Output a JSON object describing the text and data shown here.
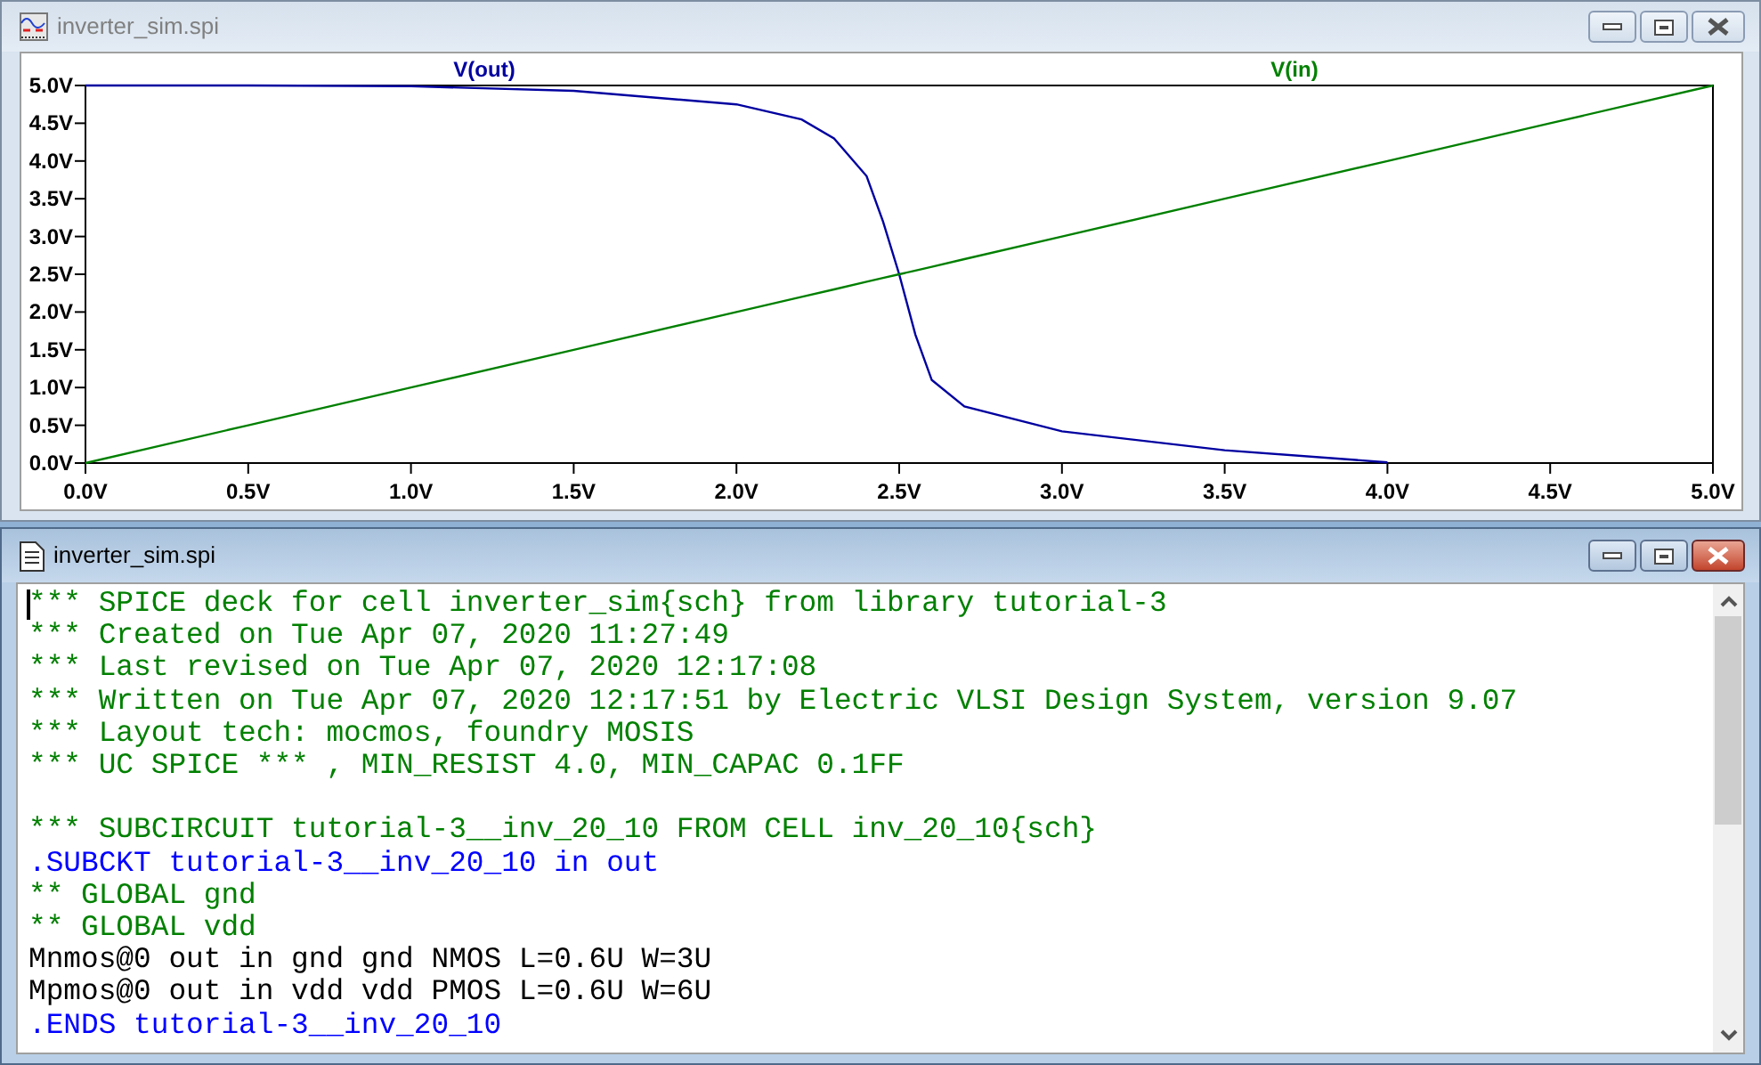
{
  "plot_window": {
    "title": "inverter_sim.spi",
    "active": false,
    "chart_data": {
      "type": "line",
      "x": [
        0,
        0.5,
        1,
        1.5,
        2,
        2.2,
        2.3,
        2.4,
        2.45,
        2.5,
        2.55,
        2.6,
        2.7,
        3,
        3.5,
        4,
        4.5,
        5
      ],
      "series": [
        {
          "name": "V(out)",
          "color": "#0000a0",
          "values": [
            5,
            5,
            4.99,
            4.93,
            4.75,
            4.55,
            4.3,
            3.8,
            3.2,
            2.5,
            1.7,
            1.1,
            0.75,
            0.42,
            0.17,
            0.01,
            null,
            null
          ]
        },
        {
          "name": "V(in)",
          "color": "#008000",
          "values": [
            0,
            0.5,
            1,
            1.5,
            2,
            2.2,
            2.3,
            2.4,
            2.45,
            2.5,
            2.55,
            2.6,
            2.7,
            3,
            3.5,
            4,
            4.5,
            5
          ]
        }
      ],
      "xlim": [
        0,
        5
      ],
      "ylim": [
        0,
        5
      ],
      "xticks": [
        {
          "value": 0,
          "label": "0.0V"
        },
        {
          "value": 0.5,
          "label": "0.5V"
        },
        {
          "value": 1,
          "label": "1.0V"
        },
        {
          "value": 1.5,
          "label": "1.5V"
        },
        {
          "value": 2,
          "label": "2.0V"
        },
        {
          "value": 2.5,
          "label": "2.5V"
        },
        {
          "value": 3,
          "label": "3.0V"
        },
        {
          "value": 3.5,
          "label": "3.5V"
        },
        {
          "value": 4,
          "label": "4.0V"
        },
        {
          "value": 4.5,
          "label": "4.5V"
        },
        {
          "value": 5,
          "label": "5.0V"
        }
      ],
      "yticks": [
        {
          "value": 0,
          "label": "0.0V"
        },
        {
          "value": 0.5,
          "label": "0.5V"
        },
        {
          "value": 1,
          "label": "1.0V"
        },
        {
          "value": 1.5,
          "label": "1.5V"
        },
        {
          "value": 2,
          "label": "2.0V"
        },
        {
          "value": 2.5,
          "label": "2.5V"
        },
        {
          "value": 3,
          "label": "3.0V"
        },
        {
          "value": 3.5,
          "label": "3.5V"
        },
        {
          "value": 4,
          "label": "4.0V"
        },
        {
          "value": 4.5,
          "label": "4.5V"
        },
        {
          "value": 5,
          "label": "5.0V"
        }
      ]
    }
  },
  "netlist_window": {
    "title": "inverter_sim.spi",
    "active": true,
    "lines": [
      {
        "kind": "comment",
        "text": "*** SPICE deck for cell inverter_sim{sch} from library tutorial-3"
      },
      {
        "kind": "comment",
        "text": "*** Created on Tue Apr 07, 2020 11:27:49"
      },
      {
        "kind": "comment",
        "text": "*** Last revised on Tue Apr 07, 2020 12:17:08"
      },
      {
        "kind": "comment",
        "text": "*** Written on Tue Apr 07, 2020 12:17:51 by Electric VLSI Design System, version 9.07"
      },
      {
        "kind": "comment",
        "text": "*** Layout tech: mocmos, foundry MOSIS"
      },
      {
        "kind": "comment",
        "text": "*** UC SPICE *** , MIN_RESIST 4.0, MIN_CAPAC 0.1FF"
      },
      {
        "kind": "blank"
      },
      {
        "kind": "comment",
        "text": "*** SUBCIRCUIT tutorial-3__inv_20_10 FROM CELL inv_20_10{sch}"
      },
      {
        "kind": "directive",
        "text": ".SUBCKT tutorial-3__inv_20_10 in out"
      },
      {
        "kind": "comment",
        "text": "** GLOBAL gnd"
      },
      {
        "kind": "comment",
        "text": "** GLOBAL vdd"
      },
      {
        "kind": "element",
        "text": "Mnmos@0 out in gnd gnd NMOS L=0.6U W=3U"
      },
      {
        "kind": "element",
        "text": "Mpmos@0 out in vdd vdd PMOS L=0.6U W=6U"
      },
      {
        "kind": "directive",
        "text": ".ENDS tutorial-3__inv_20_10"
      }
    ]
  }
}
